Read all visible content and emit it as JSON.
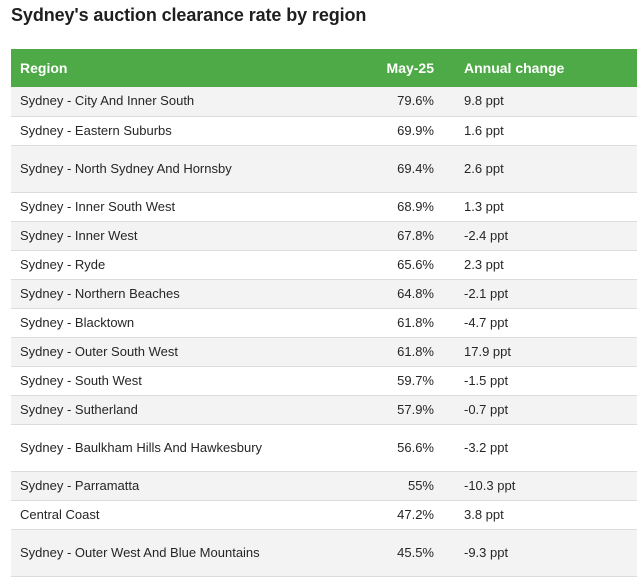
{
  "chart_data": {
    "type": "table",
    "title": "Sydney's auction clearance rate by region",
    "columns": [
      "Region",
      "May-25",
      "Annual change"
    ],
    "rows": [
      {
        "region": "Sydney - City And Inner South",
        "rate": "79.6%",
        "change": "9.8 ppt"
      },
      {
        "region": "Sydney - Eastern Suburbs",
        "rate": "69.9%",
        "change": "1.6 ppt"
      },
      {
        "region": "Sydney - North Sydney And Hornsby",
        "rate": "69.4%",
        "change": "2.6 ppt"
      },
      {
        "region": "Sydney - Inner South West",
        "rate": "68.9%",
        "change": "1.3 ppt"
      },
      {
        "region": "Sydney - Inner West",
        "rate": "67.8%",
        "change": "-2.4 ppt"
      },
      {
        "region": "Sydney - Ryde",
        "rate": "65.6%",
        "change": "2.3 ppt"
      },
      {
        "region": "Sydney - Northern Beaches",
        "rate": "64.8%",
        "change": "-2.1 ppt"
      },
      {
        "region": "Sydney - Blacktown",
        "rate": "61.8%",
        "change": "-4.7 ppt"
      },
      {
        "region": "Sydney - Outer South West",
        "rate": "61.8%",
        "change": "17.9 ppt"
      },
      {
        "region": "Sydney - South West",
        "rate": "59.7%",
        "change": "-1.5 ppt"
      },
      {
        "region": "Sydney - Sutherland",
        "rate": "57.9%",
        "change": "-0.7 ppt"
      },
      {
        "region": "Sydney - Baulkham Hills And Hawkesbury",
        "rate": "56.6%",
        "change": "-3.2 ppt"
      },
      {
        "region": "Sydney - Parramatta",
        "rate": "55%",
        "change": "-10.3 ppt"
      },
      {
        "region": "Central Coast",
        "rate": "47.2%",
        "change": "3.8 ppt"
      },
      {
        "region": "Sydney - Outer West And Blue Mountains",
        "rate": "45.5%",
        "change": "-9.3 ppt"
      }
    ]
  },
  "colors": {
    "header_bg": "#4daa46",
    "header_text": "#ffffff",
    "stripe": "#f3f3f3"
  }
}
